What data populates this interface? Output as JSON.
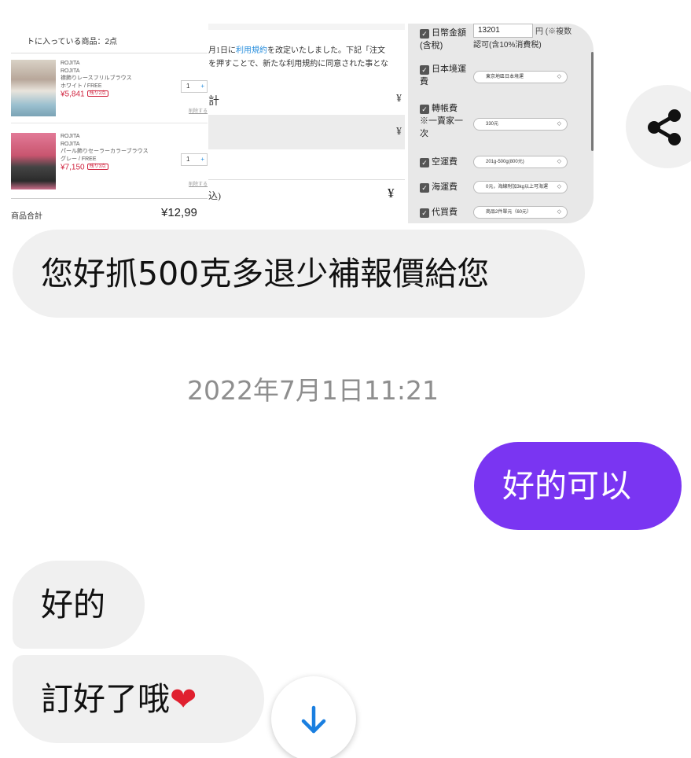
{
  "shared_image": {
    "cart": {
      "title": "トに入っている商品：2点",
      "items": [
        {
          "brand": "ROJITA",
          "brand2": "ROJITA",
          "name": "襟飾りレースフリルブラウス",
          "variant": "ホワイト / FREE",
          "price": "¥5,841",
          "badge": "残り2点",
          "qty": "1",
          "remove": "削除する"
        },
        {
          "brand": "ROJITA",
          "brand2": "ROJITA",
          "name": "パール飾りセーラーカラーブラウス",
          "variant": "グレー / FREE",
          "price": "¥7,150",
          "badge": "残り3点",
          "qty": "1",
          "remove": "削除する"
        }
      ],
      "subtotal_label": "商品合計",
      "subtotal_value": "¥12,99"
    },
    "terms": {
      "line1_pre": "月1日に",
      "line1_link": "利用規約",
      "line1_post": "を改定いたしました。下記「注文",
      "line2": "を押すことで、新たな利用規約に同意された事とな",
      "row1_label": "計",
      "row1_value": "¥",
      "row2_value": "¥",
      "tax_label": "込)",
      "total_value": "¥"
    },
    "costs": {
      "rows": [
        {
          "label": "日幣金額",
          "label2": "(含稅)",
          "input": "13201",
          "unit": "円 (※複数",
          "note": "認可(含10%消費税)"
        },
        {
          "label": "日本境運",
          "label2": "費",
          "select": "東京地區日本境運"
        },
        {
          "label": "轉帳費",
          "label2": "※一賣家一",
          "label3": "次",
          "select": "330元"
        },
        {
          "label": "空運費",
          "select": "201g-500g(800元)"
        },
        {
          "label": "海運費",
          "select": "0元，海線附加3kg以上可海運"
        },
        {
          "label": "代買費",
          "select": "商品2件單元（60元）"
        }
      ]
    }
  },
  "messages": [
    {
      "side": "incoming",
      "text": "您好抓500克多退少補報價給您"
    },
    {
      "side": "outgoing",
      "text": "好的可以"
    },
    {
      "side": "incoming",
      "text": "好的"
    },
    {
      "side": "incoming",
      "text": "訂好了哦",
      "emoji": "❤"
    }
  ],
  "timestamp": "2022年7月1日11:21",
  "icons": {
    "share": "share-icon",
    "scroll_down": "arrow-down-icon",
    "check": "✓"
  },
  "colors": {
    "outgoing_bubble": "#7a35f2",
    "incoming_bubble": "#f0f0f0",
    "scroll_arrow": "#1a7fe0"
  }
}
